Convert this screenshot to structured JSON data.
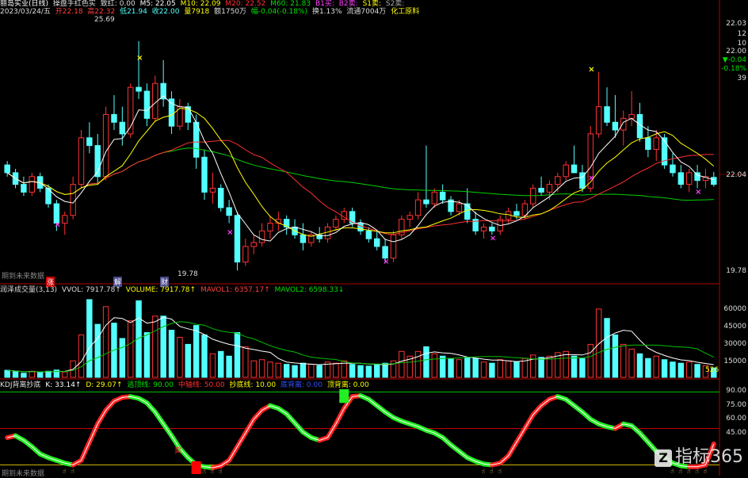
{
  "header": {
    "stock_name": "丽岛实业(日线)",
    "indicator_name": "操盘手红色实",
    "a1": "致红: 0.00",
    "ma5": "M5: 22.05",
    "ma10": "M10: 22.09",
    "ma20": "M20: 22.52",
    "ma60": "M60: 21.83",
    "b1": "B1买:",
    "b2": "B2卖:",
    "s1": "S1卖:",
    "s2": "S2卖:",
    "date": "2023/03/24/五",
    "open": "开22.18",
    "high": "高22.32",
    "low": "低21.94",
    "close": "收22.00",
    "vol": "量7918",
    "amount": "额1750万",
    "change": "幅-0.04(-0.18%)",
    "turnover": "换1.13%",
    "float": "流通7004万",
    "sector": "化工原料"
  },
  "main_panel": {
    "y_labels": [
      "22.03",
      "12",
      "10",
      "22.00",
      "▼-0.04",
      "-0.18%",
      "39",
      "22.04",
      "19.78"
    ],
    "high_label": "25.69",
    "low_label": "19.78",
    "no_data_label": "期到未来数据",
    "event_labels": [
      "涨",
      "解",
      "财"
    ]
  },
  "volume_panel": {
    "title": "润泽成交量(3,13)",
    "vvol": "VVOL: 7917.78↑",
    "volume": "VOLUME: 7917.78↑",
    "mavol1": "MAVOL1: 6357.17↑",
    "mavol2": "MAVOL2: 6598.33↓",
    "y_labels": [
      "60000",
      "45000",
      "30000",
      "15000"
    ],
    "last_label": "526"
  },
  "kdj_panel": {
    "title": "KDJ背离抄底",
    "k": "K: 33.14↑",
    "d": "D: 29.07↑",
    "overbought": "逃顶线: 90.00",
    "middle": "中轴线: 50.00",
    "bottom": "抄底线: 10.00",
    "bottom_div": "底背离: 0.00",
    "top_div": "顶背离: 0.00",
    "y_labels": [
      "90.00",
      "75.00",
      "60.00",
      "45.00"
    ],
    "no_data_label": "期到未来数据",
    "sell_label": "卖"
  },
  "watermark": {
    "logo": "Z",
    "text": "指标365"
  },
  "colors": {
    "up": "#ff3232",
    "down": "#54ffff",
    "ma5": "#ffffff",
    "ma10": "#ffff00",
    "ma20": "#ff3030",
    "ma60": "#00d000",
    "mavol1": "#ffffff",
    "mavol2": "#00c000",
    "kdj_line": "#ffffff",
    "kdj_up": "#ff2020",
    "kdj_down": "#22ee22"
  },
  "chart_data": {
    "type": "candlestick",
    "ylim": [
      19.5,
      26.3
    ],
    "volume_ylim": [
      0,
      70000
    ],
    "kdj_ylim": [
      0,
      100
    ],
    "candles": [
      [
        22.5,
        22.6,
        22.2,
        22.3
      ],
      [
        22.3,
        22.4,
        21.9,
        22.0
      ],
      [
        22.0,
        22.2,
        21.7,
        21.8
      ],
      [
        21.8,
        22.3,
        21.7,
        22.2
      ],
      [
        22.2,
        22.3,
        21.8,
        21.9
      ],
      [
        21.9,
        22.0,
        21.4,
        21.5
      ],
      [
        21.5,
        21.6,
        20.8,
        21.0
      ],
      [
        21.0,
        21.3,
        20.7,
        21.2
      ],
      [
        21.2,
        22.2,
        21.1,
        22.0
      ],
      [
        22.0,
        23.4,
        21.9,
        23.2
      ],
      [
        23.2,
        23.6,
        22.8,
        23.0
      ],
      [
        23.0,
        23.3,
        22.0,
        22.2
      ],
      [
        22.2,
        24.0,
        22.1,
        23.8
      ],
      [
        23.8,
        24.3,
        23.4,
        23.6
      ],
      [
        23.6,
        24.0,
        23.0,
        23.3
      ],
      [
        23.3,
        24.6,
        23.2,
        24.5
      ],
      [
        24.5,
        25.69,
        24.2,
        24.4
      ],
      [
        24.4,
        24.6,
        23.5,
        23.7
      ],
      [
        23.7,
        24.8,
        23.6,
        24.6
      ],
      [
        24.6,
        25.2,
        24.0,
        24.2
      ],
      [
        24.2,
        24.4,
        23.3,
        23.5
      ],
      [
        23.5,
        24.2,
        23.4,
        24.0
      ],
      [
        24.0,
        24.1,
        23.4,
        23.6
      ],
      [
        23.6,
        23.8,
        22.4,
        22.7
      ],
      [
        22.7,
        22.9,
        21.6,
        21.8
      ],
      [
        21.8,
        22.3,
        21.5,
        21.9
      ],
      [
        21.9,
        22.0,
        21.3,
        21.4
      ],
      [
        21.4,
        21.6,
        21.0,
        21.2
      ],
      [
        21.2,
        21.3,
        19.78,
        20.0
      ],
      [
        20.0,
        20.6,
        19.9,
        20.4
      ],
      [
        20.4,
        20.7,
        20.2,
        20.5
      ],
      [
        20.5,
        21.0,
        20.4,
        20.8
      ],
      [
        20.8,
        21.2,
        20.6,
        21.0
      ],
      [
        21.0,
        21.3,
        20.8,
        21.1
      ],
      [
        21.1,
        21.2,
        20.7,
        20.9
      ],
      [
        20.9,
        21.1,
        20.6,
        20.7
      ],
      [
        20.7,
        21.0,
        20.3,
        20.5
      ],
      [
        20.5,
        20.8,
        20.4,
        20.7
      ],
      [
        20.7,
        20.9,
        20.5,
        20.6
      ],
      [
        20.6,
        21.0,
        20.5,
        20.9
      ],
      [
        20.9,
        21.2,
        20.8,
        21.1
      ],
      [
        21.1,
        21.4,
        21.0,
        21.3
      ],
      [
        21.3,
        21.4,
        20.9,
        21.0
      ],
      [
        21.0,
        21.1,
        20.7,
        20.8
      ],
      [
        20.8,
        20.9,
        20.5,
        20.6
      ],
      [
        20.6,
        20.8,
        20.3,
        20.4
      ],
      [
        20.4,
        20.6,
        20.0,
        20.1
      ],
      [
        20.1,
        20.8,
        20.0,
        20.7
      ],
      [
        20.7,
        21.2,
        20.6,
        21.1
      ],
      [
        21.1,
        21.3,
        20.9,
        21.2
      ],
      [
        21.2,
        21.8,
        21.1,
        21.6
      ],
      [
        21.6,
        23.0,
        21.4,
        21.5
      ],
      [
        21.5,
        21.9,
        21.4,
        21.8
      ],
      [
        21.8,
        22.0,
        21.5,
        21.6
      ],
      [
        21.6,
        21.7,
        21.2,
        21.3
      ],
      [
        21.3,
        21.6,
        21.2,
        21.5
      ],
      [
        21.5,
        21.9,
        21.0,
        21.1
      ],
      [
        21.1,
        21.3,
        20.7,
        20.8
      ],
      [
        20.8,
        21.0,
        20.6,
        20.9
      ],
      [
        20.9,
        21.0,
        20.7,
        20.8
      ],
      [
        20.8,
        21.2,
        20.7,
        21.1
      ],
      [
        21.1,
        21.4,
        21.0,
        21.3
      ],
      [
        21.3,
        21.5,
        21.1,
        21.2
      ],
      [
        21.2,
        21.6,
        21.1,
        21.5
      ],
      [
        21.5,
        22.0,
        21.4,
        21.9
      ],
      [
        21.9,
        22.2,
        21.7,
        21.8
      ],
      [
        21.8,
        22.1,
        21.6,
        22.0
      ],
      [
        22.0,
        22.3,
        21.8,
        22.2
      ],
      [
        22.2,
        22.6,
        22.1,
        22.5
      ],
      [
        22.5,
        23.0,
        22.4,
        22.3
      ],
      [
        22.3,
        22.5,
        21.8,
        21.9
      ],
      [
        21.9,
        23.5,
        21.8,
        23.3
      ],
      [
        23.3,
        24.9,
        23.2,
        24.0
      ],
      [
        24.0,
        24.5,
        23.5,
        23.6
      ],
      [
        23.6,
        24.3,
        23.2,
        23.4
      ],
      [
        23.4,
        23.9,
        23.0,
        23.7
      ],
      [
        23.7,
        24.4,
        23.5,
        23.8
      ],
      [
        23.8,
        24.1,
        23.1,
        23.2
      ],
      [
        23.2,
        23.5,
        22.7,
        22.9
      ],
      [
        22.9,
        23.4,
        22.6,
        23.2
      ],
      [
        23.2,
        23.3,
        22.4,
        22.5
      ],
      [
        22.5,
        22.8,
        22.2,
        22.3
      ],
      [
        22.3,
        22.5,
        21.9,
        22.0
      ],
      [
        22.0,
        22.4,
        21.8,
        22.3
      ],
      [
        22.3,
        22.5,
        21.9,
        22.1
      ],
      [
        22.1,
        22.4,
        21.9,
        22.2
      ],
      [
        22.18,
        22.32,
        21.94,
        22.0
      ]
    ],
    "volume": [
      6000,
      4800,
      3500,
      5200,
      4000,
      5200,
      6200,
      4600,
      14000,
      36000,
      66000,
      45000,
      60000,
      46000,
      33000,
      48000,
      65000,
      38000,
      52000,
      52000,
      40000,
      34000,
      28000,
      44000,
      36000,
      20000,
      22000,
      18000,
      38000,
      26000,
      14000,
      15000,
      13000,
      12000,
      11000,
      10000,
      12000,
      11000,
      10000,
      13000,
      12000,
      14000,
      11000,
      10000,
      9500,
      11000,
      12000,
      14000,
      22000,
      18000,
      22000,
      26000,
      20000,
      18000,
      16000,
      15000,
      17000,
      16000,
      13000,
      12000,
      15000,
      14000,
      13000,
      16000,
      19000,
      17000,
      18000,
      21000,
      22000,
      18000,
      16000,
      28000,
      58000,
      50000,
      36000,
      28000,
      24000,
      20000,
      16000,
      18000,
      15000,
      13000,
      12000,
      13000,
      11000,
      10000,
      7918
    ],
    "kdj": [
      40,
      42,
      37,
      30,
      22,
      18,
      15,
      12,
      10,
      15,
      35,
      55,
      70,
      80,
      84,
      85,
      83,
      78,
      68,
      55,
      42,
      28,
      18,
      10,
      8,
      7,
      9,
      15,
      30,
      45,
      60,
      70,
      75,
      72,
      66,
      56,
      46,
      40,
      37,
      40,
      55,
      72,
      85,
      86,
      82,
      75,
      68,
      62,
      58,
      55,
      52,
      48,
      45,
      40,
      32,
      25,
      18,
      14,
      11,
      10,
      12,
      20,
      35,
      50,
      65,
      75,
      82,
      85,
      82,
      75,
      68,
      60,
      55,
      52,
      50,
      55,
      53,
      45,
      35,
      25,
      18,
      12,
      9,
      8,
      8,
      10,
      33
    ],
    "yellow_markers": [
      [
        16,
        25.2
      ],
      [
        71,
        24.9
      ]
    ],
    "magenta_markers": [
      [
        6,
        20.9
      ],
      [
        27,
        20.7
      ],
      [
        46,
        19.95
      ],
      [
        59,
        20.55
      ],
      [
        71,
        22.1
      ],
      [
        84,
        21.75
      ]
    ]
  }
}
